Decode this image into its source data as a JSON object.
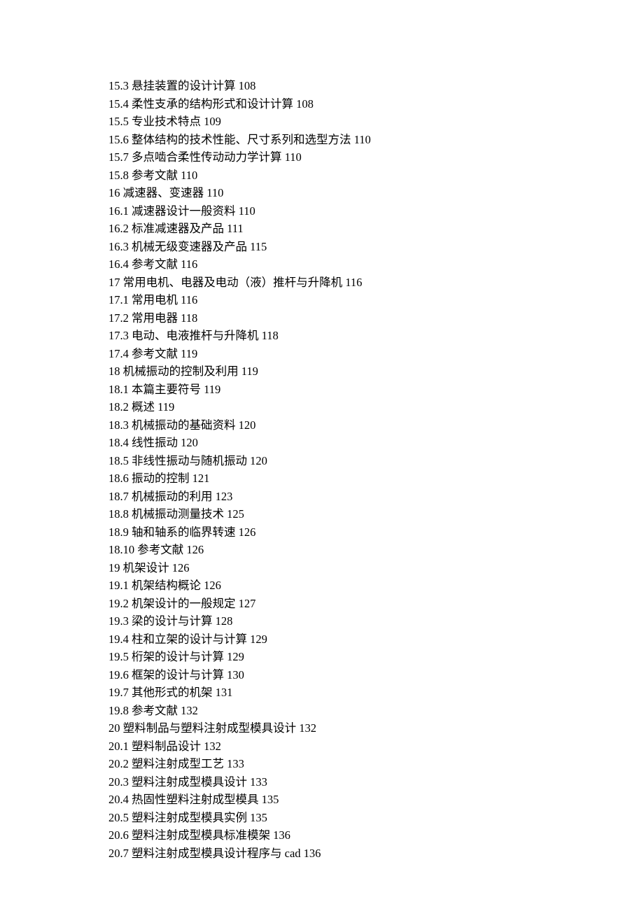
{
  "toc": [
    {
      "num": "15.3",
      "title": "悬挂装置的设计计算",
      "page": "108"
    },
    {
      "num": "15.4",
      "title": "柔性支承的结构形式和设计计算",
      "page": "108"
    },
    {
      "num": "15.5",
      "title": "专业技术特点",
      "page": "109"
    },
    {
      "num": "15.6",
      "title": "整体结构的技术性能、尺寸系列和选型方法",
      "page": "110"
    },
    {
      "num": "15.7",
      "title": "多点啮合柔性传动动力学计算",
      "page": "110"
    },
    {
      "num": "15.8",
      "title": "参考文献",
      "page": "110"
    },
    {
      "num": "16",
      "title": "减速器、变速器",
      "page": "110"
    },
    {
      "num": "16.1",
      "title": "减速器设计一般资料",
      "page": "110"
    },
    {
      "num": "16.2",
      "title": "标准减速器及产品",
      "page": "111"
    },
    {
      "num": "16.3",
      "title": "机械无级变速器及产品",
      "page": "115"
    },
    {
      "num": "16.4",
      "title": "参考文献",
      "page": "116"
    },
    {
      "num": "17",
      "title": "常用电机、电器及电动（液）推杆与升降机",
      "page": "116"
    },
    {
      "num": "17.1",
      "title": "常用电机",
      "page": "116"
    },
    {
      "num": "17.2",
      "title": "常用电器",
      "page": "118"
    },
    {
      "num": "17.3",
      "title": "电动、电液推杆与升降机",
      "page": "118"
    },
    {
      "num": "17.4",
      "title": "参考文献",
      "page": "119"
    },
    {
      "num": "18",
      "title": "机械振动的控制及利用",
      "page": "119"
    },
    {
      "num": "18.1",
      "title": "本篇主要符号",
      "page": "119"
    },
    {
      "num": "18.2",
      "title": "概述",
      "page": "119"
    },
    {
      "num": "18.3",
      "title": "机械振动的基础资料",
      "page": "120"
    },
    {
      "num": "18.4",
      "title": "线性振动",
      "page": "120"
    },
    {
      "num": "18.5",
      "title": "非线性振动与随机振动",
      "page": "120"
    },
    {
      "num": "18.6",
      "title": "振动的控制",
      "page": "121"
    },
    {
      "num": "18.7",
      "title": "机械振动的利用",
      "page": "123"
    },
    {
      "num": "18.8",
      "title": "机械振动测量技术",
      "page": "125"
    },
    {
      "num": "18.9",
      "title": "轴和轴系的临界转速",
      "page": "126"
    },
    {
      "num": "18.10",
      "title": "参考文献",
      "page": "126"
    },
    {
      "num": "19",
      "title": "机架设计",
      "page": "126"
    },
    {
      "num": "19.1",
      "title": "机架结构概论",
      "page": "126"
    },
    {
      "num": "19.2",
      "title": "机架设计的一般规定",
      "page": "127"
    },
    {
      "num": "19.3",
      "title": "梁的设计与计算",
      "page": "128"
    },
    {
      "num": "19.4",
      "title": "柱和立架的设计与计算",
      "page": "129"
    },
    {
      "num": "19.5",
      "title": "桁架的设计与计算",
      "page": "129"
    },
    {
      "num": "19.6",
      "title": "框架的设计与计算",
      "page": "130"
    },
    {
      "num": "19.7",
      "title": "其他形式的机架",
      "page": "131"
    },
    {
      "num": "19.8",
      "title": "参考文献",
      "page": "132"
    },
    {
      "num": "20",
      "title": "塑料制品与塑料注射成型模具设计",
      "page": "132"
    },
    {
      "num": "20.1",
      "title": "塑料制品设计",
      "page": "132"
    },
    {
      "num": "20.2",
      "title": "塑料注射成型工艺",
      "page": "133"
    },
    {
      "num": "20.3",
      "title": "塑料注射成型模具设计",
      "page": "133"
    },
    {
      "num": "20.4",
      "title": "热固性塑料注射成型模具",
      "page": "135"
    },
    {
      "num": "20.5",
      "title": "塑料注射成型模具实例",
      "page": "135"
    },
    {
      "num": "20.6",
      "title": "塑料注射成型模具标准模架",
      "page": "136"
    },
    {
      "num": "20.7",
      "title": "塑料注射成型模具设计程序与 cad",
      "page": "136"
    }
  ]
}
